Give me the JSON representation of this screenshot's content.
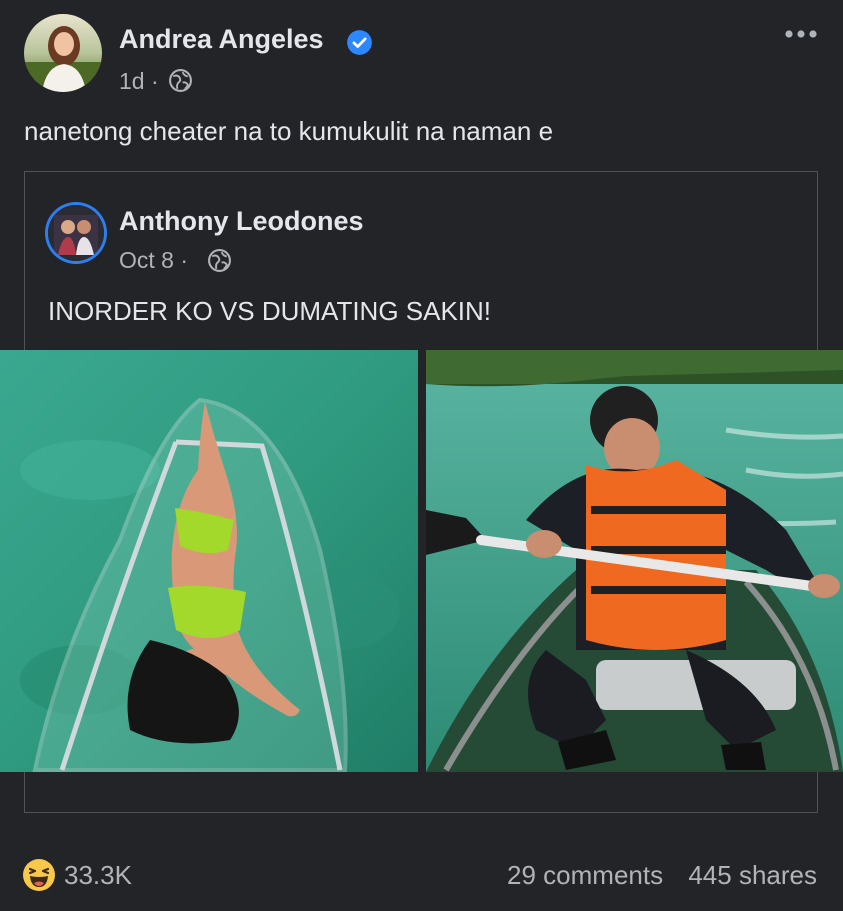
{
  "post": {
    "author_name": "Andrea Angeles",
    "verified_icon": "verified-badge-icon",
    "time": "1d",
    "separator": "·",
    "audience_icon": "globe-icon",
    "more_icon": "more-options-icon",
    "text": "nanetong cheater na to kumukulit na naman e"
  },
  "shared": {
    "author_name": "Anthony Leodones",
    "time": "Oct 8",
    "separator": "·",
    "audience_icon": "globe-icon",
    "text": "INORDER KO VS DUMATING SAKIN!",
    "photos": [
      "photo-woman-bikini-clear-kayak",
      "photo-woman-life-vest-canoe"
    ]
  },
  "footer": {
    "reaction_icon": "laughing-emoji-icon",
    "reaction_count": "33.3K",
    "comments": "29 comments",
    "shares": "445 shares"
  },
  "colors": {
    "background": "#232427",
    "text_primary": "#e4e6eb",
    "text_secondary": "#b0b3b8",
    "verified_blue": "#2d88ff",
    "reaction_yellow": "#f7c84a",
    "border": "#505257"
  }
}
